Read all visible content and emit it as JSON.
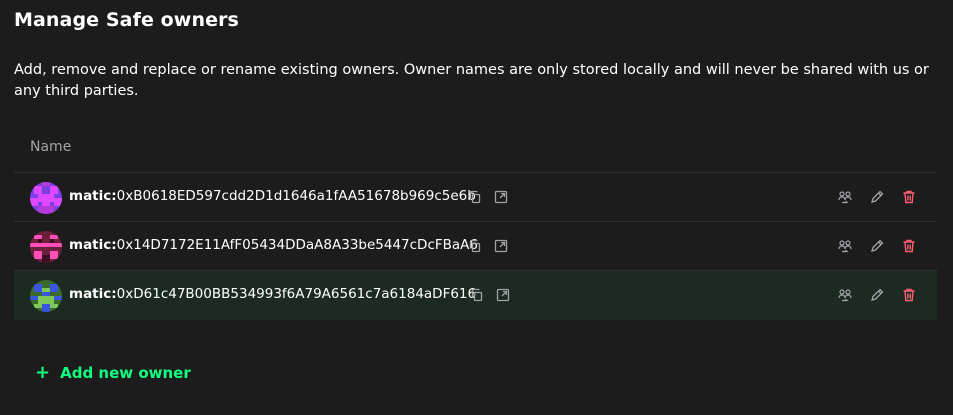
{
  "header": {
    "title": "Manage Safe owners",
    "description": "Add, remove and replace or rename existing owners. Owner names are only stored locally and will never be shared with us or any third parties."
  },
  "table": {
    "column_name": "Name",
    "owners": [
      {
        "prefix": "matic:",
        "address": "0xB0618ED597cdd2D1d1646a1fAA51678b969c5e6b"
      },
      {
        "prefix": "matic:",
        "address": "0x14D7172E11AfF05434DDaA8A33be5447cDcFBaA6"
      },
      {
        "prefix": "matic:",
        "address": "0xD61c47B00BB534993f6A79A6561c7a6184aDF616"
      }
    ]
  },
  "add_owner": {
    "label": "Add new owner",
    "icon": "plus-icon"
  },
  "colors": {
    "background": "#1c1c1c",
    "accent": "#12ff80",
    "danger": "#ff5f72",
    "muted": "#a1a3a7",
    "highlight_row": "#1c2a21"
  },
  "icons": {
    "copy": "copy-icon",
    "external_link": "external-link-icon",
    "replace_owner": "replace-owner-icon",
    "edit": "edit-icon",
    "delete": "trash-icon"
  }
}
